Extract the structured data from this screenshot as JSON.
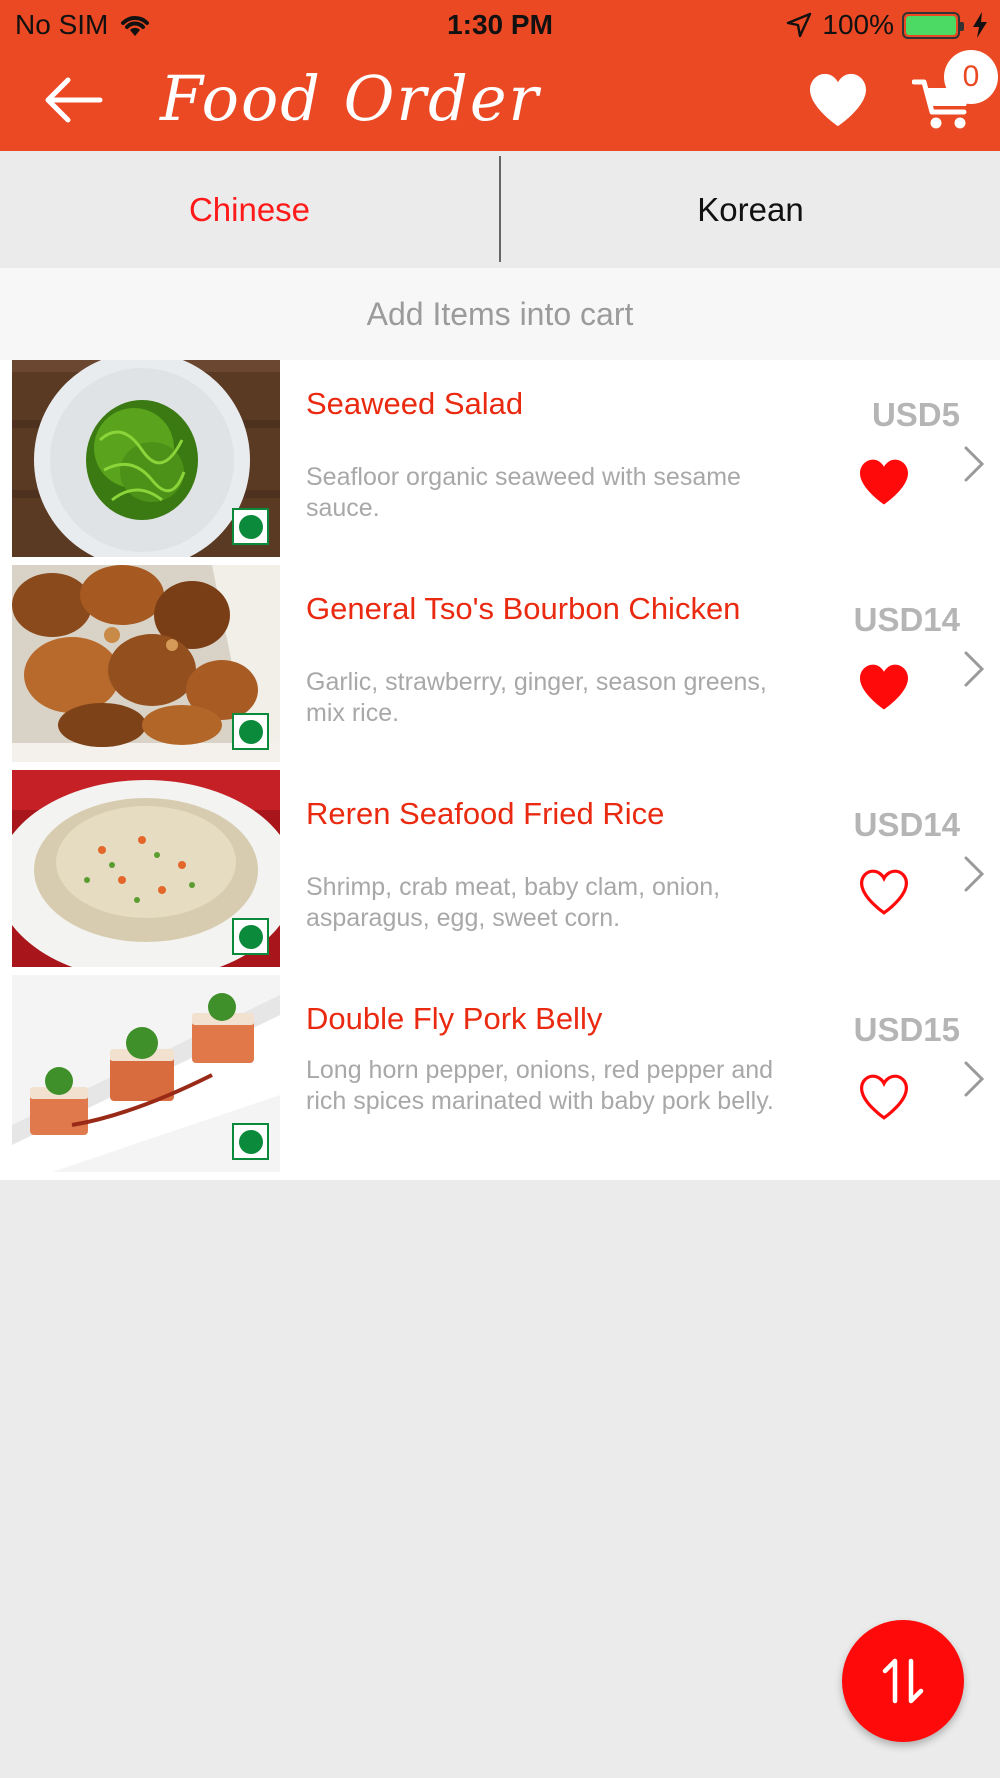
{
  "status_bar": {
    "carrier": "No SIM",
    "time": "1:30 PM",
    "battery": "100%"
  },
  "nav": {
    "title": "Food Order",
    "cart_count": "0"
  },
  "tabs": [
    {
      "label": "Chinese",
      "active": true
    },
    {
      "label": "Korean",
      "active": false
    }
  ],
  "subheader": "Add Items into cart",
  "items": [
    {
      "name": "Seaweed Salad",
      "description": "Seafloor organic seaweed with sesame sauce.",
      "price": "USD5",
      "favorite": true
    },
    {
      "name": "General Tso's Bourbon Chicken",
      "description": "Garlic, strawberry, ginger, season greens, mix rice.",
      "price": "USD14",
      "favorite": true
    },
    {
      "name": "Reren Seafood Fried Rice",
      "description": "Shrimp, crab meat, baby clam, onion, asparagus, egg, sweet corn.",
      "price": "USD14",
      "favorite": false
    },
    {
      "name": "Double Fly Pork Belly",
      "description": "Long horn pepper, onions, red pepper and rich spices marinated with baby pork belly.",
      "price": "USD15",
      "favorite": false
    }
  ],
  "colors": {
    "primary": "#ea4923",
    "accent_red": "#ff0a0a",
    "veg_green": "#0a8a3a"
  }
}
